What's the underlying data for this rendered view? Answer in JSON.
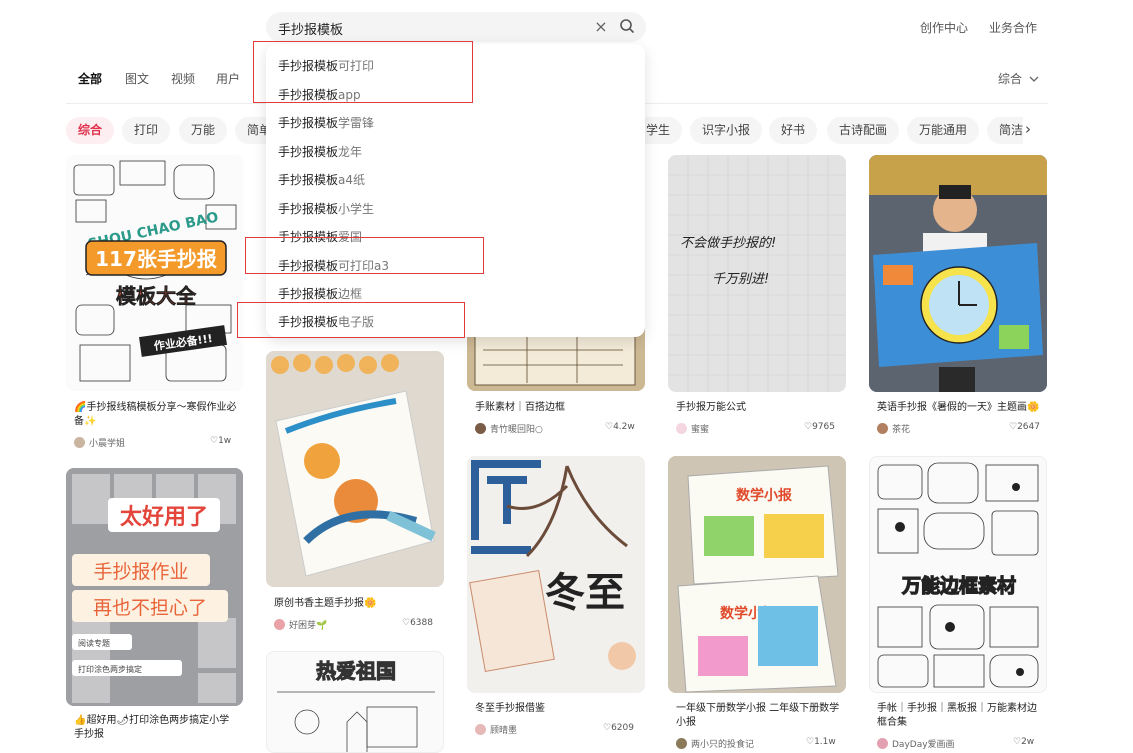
{
  "search": {
    "query": "手抄报模板",
    "clear_label": "×"
  },
  "header": {
    "links": [
      "创作中心",
      "业务合作"
    ]
  },
  "tabs": [
    "全部",
    "图文",
    "视频",
    "用户"
  ],
  "sort": {
    "label": "综合"
  },
  "chips": [
    "综合",
    "打印",
    "万能",
    "简单",
    "学生",
    "识字小报",
    "好书",
    "古诗配画",
    "万能通用",
    "简洁"
  ],
  "suggestions": [
    {
      "prefix": "手抄报模板",
      "rest": "可打印"
    },
    {
      "prefix": "手抄报模板",
      "rest": "app"
    },
    {
      "prefix": "手抄报模板",
      "rest": "学雷锋"
    },
    {
      "prefix": "手抄报模板",
      "rest": "龙年"
    },
    {
      "prefix": "手抄报模板",
      "rest": "a4纸"
    },
    {
      "prefix": "手抄报模板",
      "rest": "小学生"
    },
    {
      "prefix": "手抄报模板",
      "rest": "爱国"
    },
    {
      "prefix": "手抄报模板",
      "rest": "可打印a3"
    },
    {
      "prefix": "手抄报模板",
      "rest": "边框"
    },
    {
      "prefix": "手抄报模板",
      "rest": "电子版"
    }
  ],
  "cards": [
    {
      "caption": "🌈手抄报线稿模板分享～寒假作业必备✨",
      "author": "小晨学姐",
      "likes": "1w",
      "image_text": [
        "SHOU CHAO BAO",
        "117张手抄报",
        "模板大全",
        "作业必备!!!"
      ],
      "avatar_color": "#c9b5a0"
    },
    {
      "caption": "👍超好用🌶打印涂色两步搞定小学手抄报",
      "author": "",
      "likes": "",
      "image_text": [
        "太好用了",
        "手抄报作业",
        "再也不担心了",
        "阅读专题",
        "打印涂色两步搞定"
      ],
      "avatar_color": "#a7b8d0"
    },
    {
      "caption": "原创书香主题手抄报🌼",
      "author": "好困芽🌱",
      "likes": "6388",
      "image_text": [],
      "avatar_color": "#e8a2a8"
    },
    {
      "caption": "",
      "author": "",
      "likes": "",
      "image_text": [
        "热爱祖国"
      ],
      "avatar_color": "#ccc"
    },
    {
      "caption": "手账素材｜百搭边框",
      "author": "青竹暖回阳○",
      "likes": "4.2w",
      "image_text": [],
      "avatar_color": "#7a5b46"
    },
    {
      "caption": "冬至手抄报借鉴",
      "author": "顾晴墨",
      "likes": "6209",
      "image_text": [
        "冬至"
      ],
      "avatar_color": "#e6b8b8"
    },
    {
      "caption": "手抄报万能公式",
      "author": "蜜蜜",
      "likes": "9765",
      "image_text": [
        "不会做手抄报的!",
        "千万别进!"
      ],
      "avatar_color": "#f3d6e0"
    },
    {
      "caption": "一年级下册数学小报 二年级下册数学小报",
      "author": "两小只的投食记",
      "likes": "1.1w",
      "image_text": [
        "数学小报",
        "数学小报"
      ],
      "avatar_color": "#8a7a5a"
    },
    {
      "caption": "英语手抄报《暑假的一天》主题画🌼",
      "author": "茶花",
      "likes": "2647",
      "image_text": [],
      "avatar_color": "#b08060"
    },
    {
      "caption": "手帐｜手抄报｜黑板报｜万能素材边框合集",
      "author": "DayDay爱画画",
      "likes": "2w",
      "image_text": [
        "万能边框素材"
      ],
      "avatar_color": "#e3a0b0"
    }
  ],
  "colors": {
    "accent": "#e0324c",
    "highlight_box": "#e23b3b"
  }
}
